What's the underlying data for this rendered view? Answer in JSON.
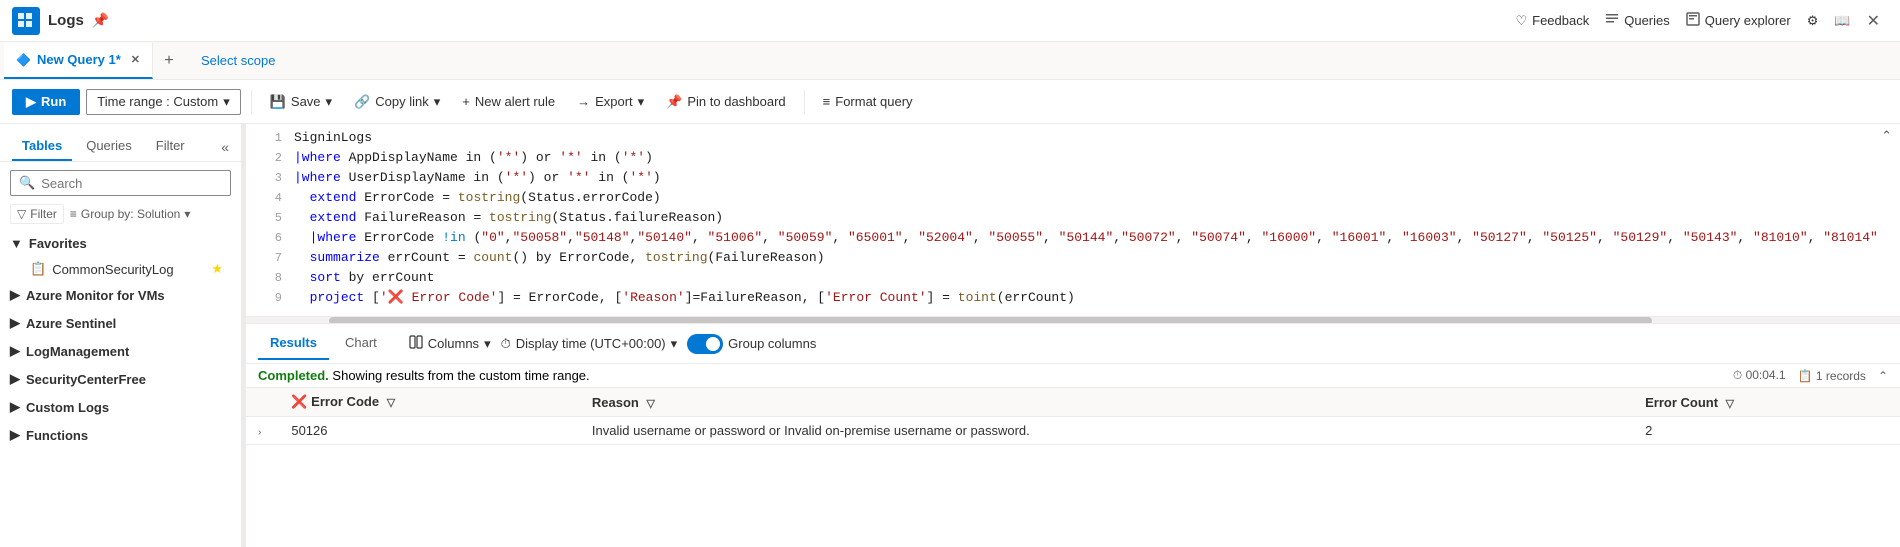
{
  "titleBar": {
    "appName": "Logs",
    "pinLabel": "📌",
    "closeLabel": "✕"
  },
  "tabs": [
    {
      "id": "new-query-1",
      "label": "New Query 1*",
      "active": true,
      "icon": "🔷"
    }
  ],
  "tabAdd": "+",
  "topActions": [
    {
      "id": "feedback",
      "icon": "♡",
      "label": "Feedback"
    },
    {
      "id": "queries",
      "icon": "≡",
      "label": "Queries"
    },
    {
      "id": "query-explorer",
      "icon": "⬜",
      "label": "Query explorer"
    },
    {
      "id": "settings",
      "icon": "⚙",
      "label": ""
    },
    {
      "id": "docs",
      "icon": "📖",
      "label": ""
    }
  ],
  "toolbar": {
    "runLabel": "Run",
    "timeRangeLabel": "Time range : Custom",
    "saveLabel": "Save",
    "copyLinkLabel": "Copy link",
    "newAlertLabel": "New alert rule",
    "exportLabel": "Export",
    "pinDashboardLabel": "Pin to dashboard",
    "formatQueryLabel": "Format query"
  },
  "sidebar": {
    "tabs": [
      "Tables",
      "Queries",
      "Filter"
    ],
    "searchPlaceholder": "Search",
    "filterLabel": "Filter",
    "groupByLabel": "Group by: Solution",
    "sections": [
      {
        "id": "favorites",
        "label": "Favorites",
        "items": [
          {
            "label": "CommonSecurityLog",
            "starred": true
          }
        ]
      },
      {
        "id": "azure-monitor-vms",
        "label": "Azure Monitor for VMs",
        "items": []
      },
      {
        "id": "azure-sentinel",
        "label": "Azure Sentinel",
        "items": []
      },
      {
        "id": "log-management",
        "label": "LogManagement",
        "items": []
      },
      {
        "id": "security-center-free",
        "label": "SecurityCenterFree",
        "items": []
      },
      {
        "id": "custom-logs",
        "label": "Custom Logs",
        "items": []
      },
      {
        "id": "functions",
        "label": "Functions",
        "items": []
      }
    ]
  },
  "editor": {
    "lines": [
      {
        "num": 1,
        "content": "SigninLogs"
      },
      {
        "num": 2,
        "content": "| where AppDisplayName in ('*') or '*' in ('*')"
      },
      {
        "num": 3,
        "content": "| where UserDisplayName in ('*') or '*' in ('*')"
      },
      {
        "num": 4,
        "content": "| extend ErrorCode = tostring(Status.errorCode)"
      },
      {
        "num": 5,
        "content": "| extend FailureReason = tostring(Status.failureReason)"
      },
      {
        "num": 6,
        "content": "| where ErrorCode !in (\"0\",\"50058\",\"50148\",\"50140\", \"51006\", \"50059\", \"65001\", \"52004\", \"50055\", \"50144\",\"50072\", \"50074\", \"16000\", \"16001\", \"16003\", \"50127\", \"50125\", \"50129\", \"50143\", \"81010\", \"81014\""
      },
      {
        "num": 7,
        "content": "| summarize errCount = count() by ErrorCode, tostring(FailureReason)"
      },
      {
        "num": 8,
        "content": "| sort by errCount"
      },
      {
        "num": 9,
        "content": "| project ['❌ Error Code'] = ErrorCode, ['Reason']=FailureReason, ['Error Count'] = toint(errCount)"
      }
    ]
  },
  "results": {
    "tabs": [
      "Results",
      "Chart"
    ],
    "columnsLabel": "Columns",
    "displayTimeLabel": "Display time (UTC+00:00)",
    "groupColumnsLabel": "Group columns",
    "statusText": "Completed.",
    "statusDetail": "Showing results from the custom time range.",
    "duration": "00:04.1",
    "recordCount": "1 records",
    "columns": [
      {
        "id": "error-code",
        "label": "Error Code"
      },
      {
        "id": "reason",
        "label": "Reason"
      },
      {
        "id": "error-count",
        "label": "Error Count"
      }
    ],
    "rows": [
      {
        "expand": "›",
        "errorCode": "50126",
        "reason": "Invalid username or password or Invalid on-premise username or password.",
        "errorCount": "2"
      }
    ]
  }
}
